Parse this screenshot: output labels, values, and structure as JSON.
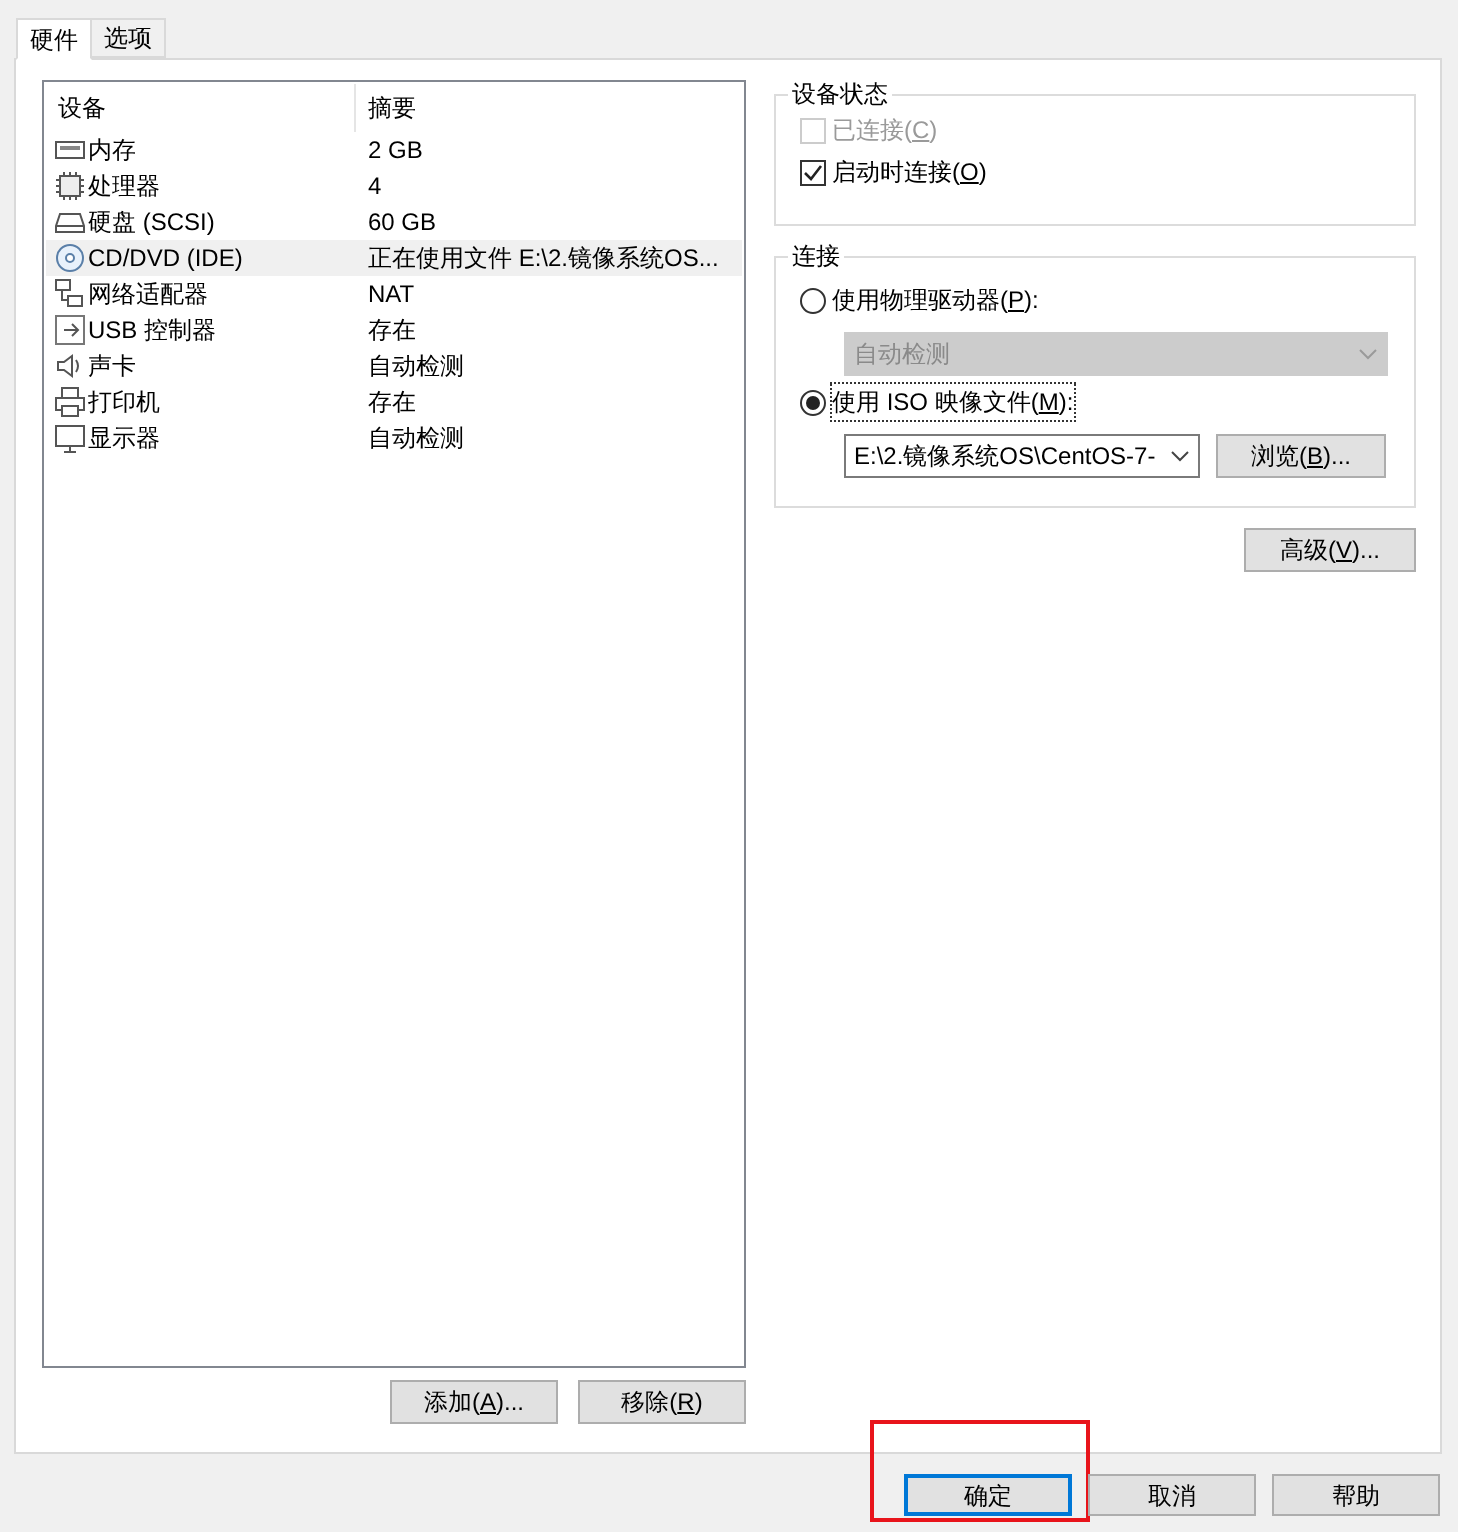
{
  "tabs": [
    {
      "label": "硬件",
      "selected": true
    },
    {
      "label": "选项",
      "selected": false
    }
  ],
  "device_list": {
    "columns": [
      "设备",
      "摘要"
    ],
    "rows": [
      {
        "device": "内存",
        "summary": "2 GB",
        "selected": false
      },
      {
        "device": "处理器",
        "summary": "4",
        "selected": false
      },
      {
        "device": "硬盘 (SCSI)",
        "summary": "60 GB",
        "selected": false
      },
      {
        "device": "CD/DVD (IDE)",
        "summary": "正在使用文件 E:\\2.镜像系统OS...",
        "selected": true
      },
      {
        "device": "网络适配器",
        "summary": "NAT",
        "selected": false
      },
      {
        "device": "USB 控制器",
        "summary": "存在",
        "selected": false
      },
      {
        "device": "声卡",
        "summary": "自动检测",
        "selected": false
      },
      {
        "device": "打印机",
        "summary": "存在",
        "selected": false
      },
      {
        "device": "显示器",
        "summary": "自动检测",
        "selected": false
      }
    ]
  },
  "list_buttons": [
    {
      "label_parts": [
        "添加(",
        "A",
        ")..."
      ]
    },
    {
      "label_parts": [
        "移除(",
        "R",
        ")"
      ]
    }
  ],
  "device_status": {
    "title": "设备状态",
    "checkboxes": [
      {
        "label_parts": [
          "已连接(",
          "C",
          ")"
        ],
        "checked": false,
        "disabled": true
      },
      {
        "label_parts": [
          "启动时连接(",
          "O",
          ")"
        ],
        "checked": true,
        "disabled": false
      }
    ]
  },
  "connection": {
    "title": "连接",
    "options": [
      {
        "label_parts": [
          "使用物理驱动器(",
          "P",
          "):"
        ],
        "selected": false,
        "dropdown": {
          "value": "自动检测",
          "disabled": true
        }
      },
      {
        "label_parts": [
          "使用 ISO 映像文件(",
          "M",
          "):"
        ],
        "selected": true,
        "dropdown": {
          "value": "E:\\2.镜像系统OS\\CentOS-7-",
          "disabled": false
        },
        "button": {
          "label_parts": [
            "浏览(",
            "B",
            ")..."
          ]
        }
      }
    ]
  },
  "advanced_button": {
    "label_parts": [
      "高级(",
      "V",
      ")..."
    ]
  },
  "dialog_buttons": [
    {
      "label": "确定",
      "default": true,
      "highlighted": true
    },
    {
      "label": "取消",
      "default": false,
      "highlighted": false
    },
    {
      "label": "帮助",
      "default": false,
      "highlighted": false
    }
  ]
}
